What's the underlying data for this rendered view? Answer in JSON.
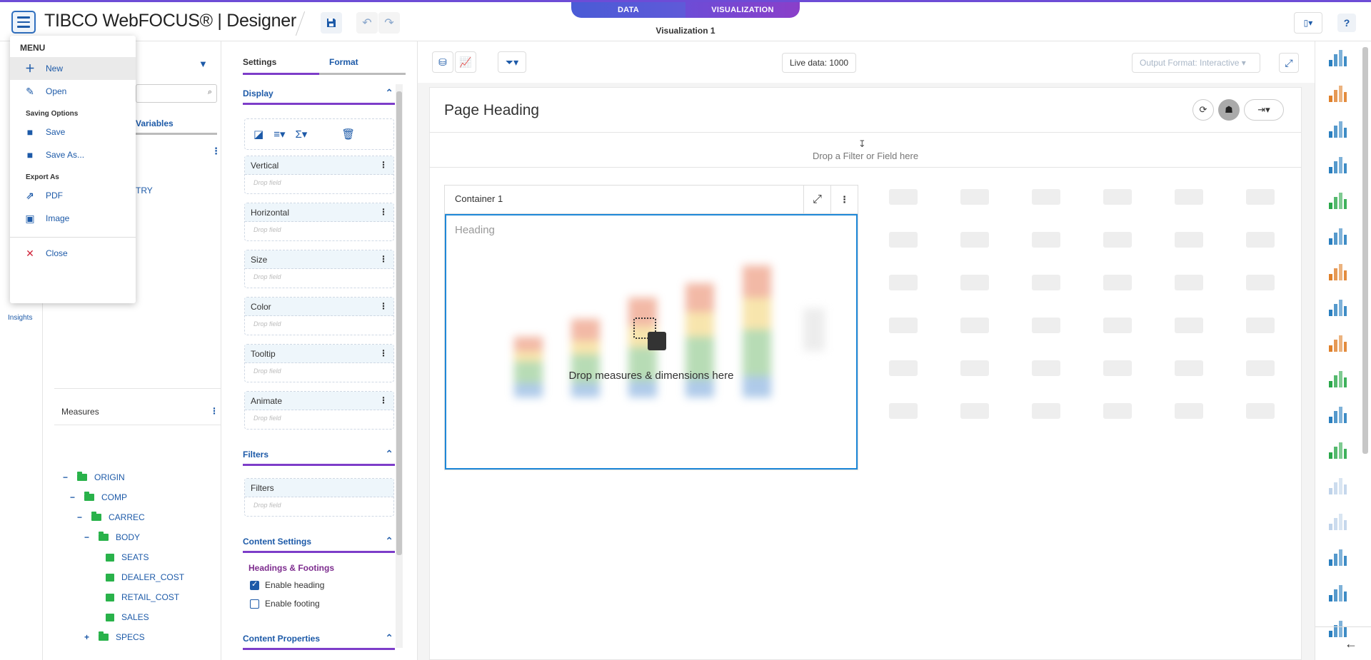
{
  "header": {
    "brand": "TIBCO WebFOCUS® | Designer",
    "modes": [
      "DATA",
      "VISUALIZATION"
    ],
    "visualization_title": "Visualization 1"
  },
  "menu": {
    "title": "MENU",
    "items_top": [
      {
        "label": "New",
        "icon": "plus-icon"
      },
      {
        "label": "Open",
        "icon": "open-icon"
      }
    ],
    "saving_title": "Saving Options",
    "saving": [
      {
        "label": "Save",
        "icon": "save-icon"
      },
      {
        "label": "Save As...",
        "icon": "save-as-icon"
      }
    ],
    "export_title": "Export As",
    "export": [
      {
        "label": "PDF",
        "icon": "pdf-export-icon"
      },
      {
        "label": "Image",
        "icon": "image-export-icon"
      }
    ],
    "close": "Close"
  },
  "left_rail": {
    "insights": "Insights"
  },
  "data_panel": {
    "variables_tab": "Variables",
    "partial_item": "TRY",
    "measures_header": "Measures",
    "tree": [
      {
        "label": "ORIGIN",
        "level": 0,
        "type": "folder",
        "toggle": "−"
      },
      {
        "label": "COMP",
        "level": 1,
        "type": "folder",
        "toggle": "−"
      },
      {
        "label": "CARREC",
        "level": 2,
        "type": "folder",
        "toggle": "−"
      },
      {
        "label": "BODY",
        "level": 3,
        "type": "folder",
        "toggle": "−"
      },
      {
        "label": "SEATS",
        "level": 4,
        "type": "measure",
        "toggle": ""
      },
      {
        "label": "DEALER_COST",
        "level": 4,
        "type": "measure",
        "toggle": ""
      },
      {
        "label": "RETAIL_COST",
        "level": 4,
        "type": "measure",
        "toggle": ""
      },
      {
        "label": "SALES",
        "level": 4,
        "type": "measure",
        "toggle": ""
      },
      {
        "label": "SPECS",
        "level": 3,
        "type": "folder",
        "toggle": "+"
      }
    ]
  },
  "settings": {
    "tab_settings": "Settings",
    "tab_format": "Format",
    "display": "Display",
    "wells": [
      {
        "label": "Vertical",
        "drop": "Drop field"
      },
      {
        "label": "Horizontal",
        "drop": "Drop field"
      },
      {
        "label": "Size",
        "drop": "Drop field"
      },
      {
        "label": "Color",
        "drop": "Drop field"
      },
      {
        "label": "Tooltip",
        "drop": "Drop field"
      },
      {
        "label": "Animate",
        "drop": "Drop field"
      }
    ],
    "filters_header": "Filters",
    "filters_well": {
      "label": "Filters",
      "drop": "Drop field"
    },
    "content_settings": "Content Settings",
    "headings_footings": "Headings & Footings",
    "enable_heading": "Enable heading",
    "enable_heading_checked": true,
    "enable_footing": "Enable footing",
    "enable_footing_checked": false,
    "content_properties": "Content Properties"
  },
  "canvas": {
    "live_data": "Live data: 1000",
    "output_format": "Output Format: Interactive",
    "page_heading": "Page Heading",
    "drop_filter": "Drop a Filter or Field here",
    "container_title": "Container 1",
    "heading": "Heading",
    "drop_measures": "Drop measures & dimensions here"
  },
  "colors": {
    "accent": "#1d5aa8",
    "purple": "#7d3dc9",
    "selection": "#1e88d8"
  }
}
